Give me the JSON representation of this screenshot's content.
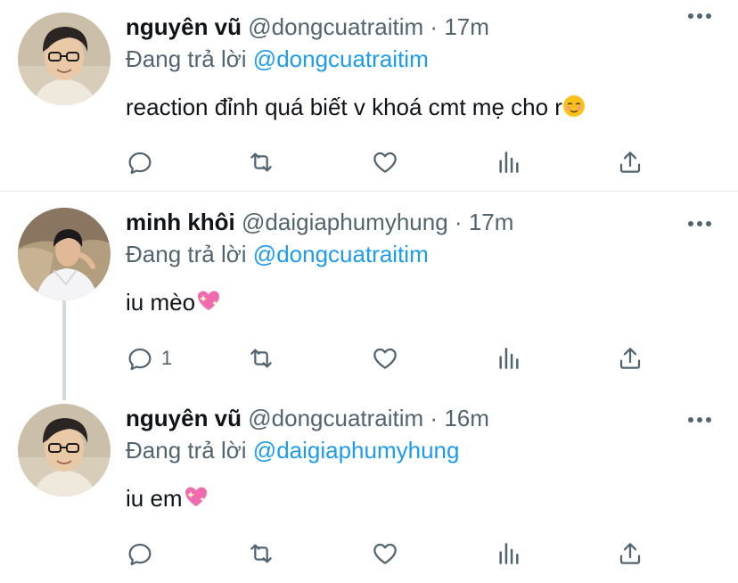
{
  "tweets": [
    {
      "name": "nguyên vũ",
      "handle": "@dongcuatraitim",
      "dot": "·",
      "time": "17m",
      "reply_prefix": "Đang trả lời",
      "reply_mention": "@dongcuatraitim",
      "text": "reaction đỉnh quá biết v khoá cmt mẹ cho r",
      "emoji": "relieved-face-emoji",
      "reply_count": "",
      "avatar": "man-with-glasses-photo"
    },
    {
      "name": "minh khôi",
      "handle": "@daigiaphumyhung",
      "dot": "·",
      "time": "17m",
      "reply_prefix": "Đang trả lời",
      "reply_mention": "@dongcuatraitim",
      "text": "iu mèo",
      "emoji": "sparkling-heart-emoji",
      "reply_count": "1",
      "avatar": "man-outdoor-photo"
    },
    {
      "name": "nguyên vũ",
      "handle": "@dongcuatraitim",
      "dot": "·",
      "time": "16m",
      "reply_prefix": "Đang trả lời",
      "reply_mention": "@daigiaphumyhung",
      "text": "iu em",
      "emoji": "sparkling-heart-emoji",
      "reply_count": "",
      "avatar": "man-with-glasses-photo"
    }
  ],
  "colors": {
    "accent": "#1d9bf0",
    "secondary_text": "#536471",
    "primary_text": "#0f1419",
    "divider": "#e6ecf0",
    "heart_emoji": "#f06ab0"
  },
  "action_icons": [
    "reply-icon",
    "retweet-icon",
    "like-icon",
    "analytics-icon",
    "share-icon"
  ]
}
